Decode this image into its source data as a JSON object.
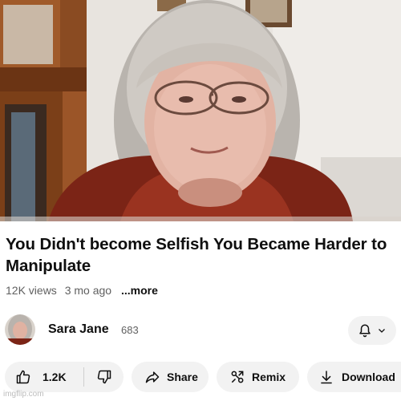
{
  "video": {
    "title": "You Didn't become Selfish You Became Harder to Manipulate"
  },
  "meta": {
    "views": "12K views",
    "age": "3 mo ago",
    "more": "...more"
  },
  "channel": {
    "name": "Sara Jane",
    "subscribers": "683"
  },
  "actions": {
    "likes": "1.2K",
    "share": "Share",
    "remix": "Remix",
    "download": "Download"
  },
  "watermark": "imgflip.com",
  "icons": [
    "thumbs-up-icon",
    "thumbs-down-icon",
    "share-arrow-icon",
    "remix-icon",
    "download-icon",
    "bell-icon",
    "chevron-down-icon"
  ]
}
